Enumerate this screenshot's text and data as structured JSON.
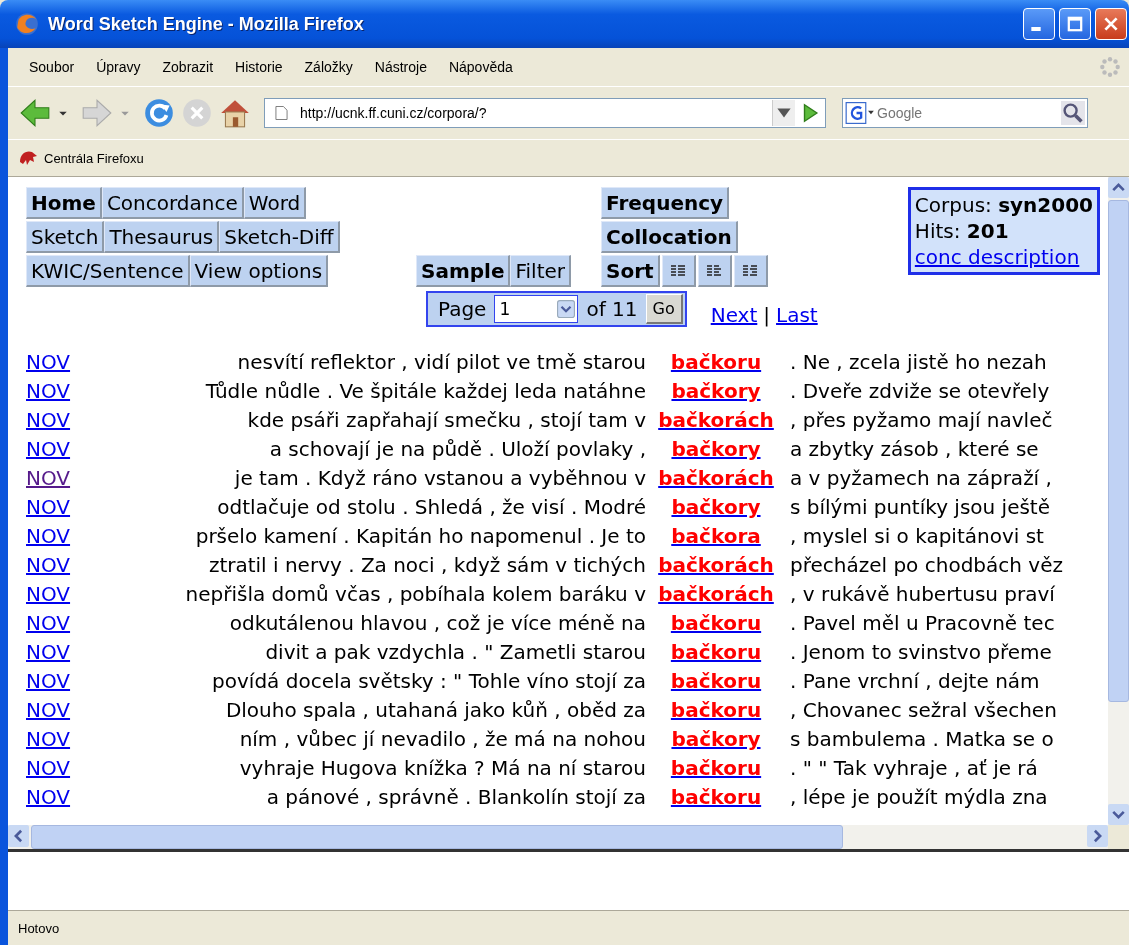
{
  "window": {
    "title": "Word Sketch Engine - Mozilla Firefox"
  },
  "menu": [
    "Soubor",
    "Úpravy",
    "Zobrazit",
    "Historie",
    "Záložky",
    "Nástroje",
    "Nápověda"
  ],
  "address_bar": {
    "value": "http://ucnk.ff.cuni.cz/corpora/?"
  },
  "search": {
    "placeholder": "Google"
  },
  "bookmarks": [
    "Centrála Firefoxu"
  ],
  "nav_buttons": [
    [
      {
        "label": "Home",
        "bold": true
      },
      {
        "label": "Concordance",
        "bold": false
      },
      {
        "label": "Word",
        "bold": false
      }
    ],
    [
      {
        "label": "Sketch",
        "bold": false
      },
      {
        "label": "Thesaurus",
        "bold": false
      },
      {
        "label": "Sketch-Diff",
        "bold": false
      }
    ],
    [
      {
        "label": "KWIC/Sentence",
        "bold": false
      },
      {
        "label": "View options",
        "bold": false
      }
    ]
  ],
  "action_buttons": [
    {
      "label": "Sample",
      "bold": true
    },
    {
      "label": "Filter",
      "bold": false
    }
  ],
  "analysis_buttons": [
    {
      "label": "Frequency",
      "bold": true
    },
    {
      "label": "Collocation",
      "bold": true
    },
    {
      "label": "Sort",
      "bold": true
    }
  ],
  "pager": {
    "label": "Page",
    "page": "1",
    "total": "of 11",
    "button": "Go",
    "links": [
      "Next",
      "Last"
    ],
    "separator": "|"
  },
  "corpus_info": {
    "corpus_label": "Corpus:",
    "corpus": "syn2000",
    "hits_label": "Hits:",
    "hits": "201",
    "link": "conc description"
  },
  "concordance": [
    {
      "ref": "NOV",
      "visited": false,
      "left": "nesvítí reflektor , vidí pilot ve tmě starou",
      "keyword": "bačkoru",
      "right": ". Ne , zcela jistě ho nezah"
    },
    {
      "ref": "NOV",
      "visited": false,
      "left": "Tůdle nůdle . Ve špitále každej leda natáhne",
      "keyword": "bačkory",
      "right": ". Dveře zdviže se otevřely"
    },
    {
      "ref": "NOV",
      "visited": false,
      "left": "kde psáři zapřahají smečku , stojí tam v",
      "keyword": "bačkorách",
      "right": ", přes pyžamo mají navleč"
    },
    {
      "ref": "NOV",
      "visited": false,
      "left": "a schovají je na půdě . Uloží povlaky ,",
      "keyword": "bačkory",
      "right": "a zbytky zásob , které se"
    },
    {
      "ref": "NOV",
      "visited": true,
      "left": "je tam . Když ráno vstanou a vyběhnou v",
      "keyword": "bačkorách",
      "right": "a v pyžamech na zápraží ,"
    },
    {
      "ref": "NOV",
      "visited": false,
      "left": "odtlačuje od stolu . Shledá , že visí . Modré",
      "keyword": "bačkory",
      "right": "s bílými puntíky jsou ještě"
    },
    {
      "ref": "NOV",
      "visited": false,
      "left": "pršelo kamení . Kapitán ho napomenul . Je to",
      "keyword": "bačkora",
      "right": ", myslel si o kapitánovi st"
    },
    {
      "ref": "NOV",
      "visited": false,
      "left": "ztratil i nervy . Za noci , když sám v tichých",
      "keyword": "bačkorách",
      "right": "přecházel po chodbách věz"
    },
    {
      "ref": "NOV",
      "visited": false,
      "left": "nepřišla domů včas , pobíhala kolem baráku v",
      "keyword": "bačkorách",
      "right": ", v rukávě hubertusu praví"
    },
    {
      "ref": "NOV",
      "visited": false,
      "left": "odkutálenou hlavou , což je více méně na",
      "keyword": "bačkoru",
      "right": ". Pavel měl u Pracovně tec"
    },
    {
      "ref": "NOV",
      "visited": false,
      "left": "divit a pak vzdychla . \" Zametli starou",
      "keyword": "bačkoru",
      "right": ". Jenom to svinstvo přeme"
    },
    {
      "ref": "NOV",
      "visited": false,
      "left": "povídá docela světsky : \" Tohle víno stojí za",
      "keyword": "bačkoru",
      "right": ". Pane vrchní , dejte nám"
    },
    {
      "ref": "NOV",
      "visited": false,
      "left": "Dlouho spala , utahaná jako kůň , oběd za",
      "keyword": "bačkoru",
      "right": ", Chovanec sežral všechen"
    },
    {
      "ref": "NOV",
      "visited": false,
      "left": "ním , vůbec jí nevadilo , že má na nohou",
      "keyword": "bačkory",
      "right": "s bambulema . Matka se o"
    },
    {
      "ref": "NOV",
      "visited": false,
      "left": "vyhraje Hugova knížka ? Má na ní starou",
      "keyword": "bačkoru",
      "right": ". \" \" Tak vyhraje , ať je rá"
    },
    {
      "ref": "NOV",
      "visited": false,
      "left": "a pánové , správně . Blankolín stojí za",
      "keyword": "bačkoru",
      "right": ", lépe je použít mýdla zna"
    }
  ],
  "status_bar": {
    "text": "Hotovo"
  }
}
